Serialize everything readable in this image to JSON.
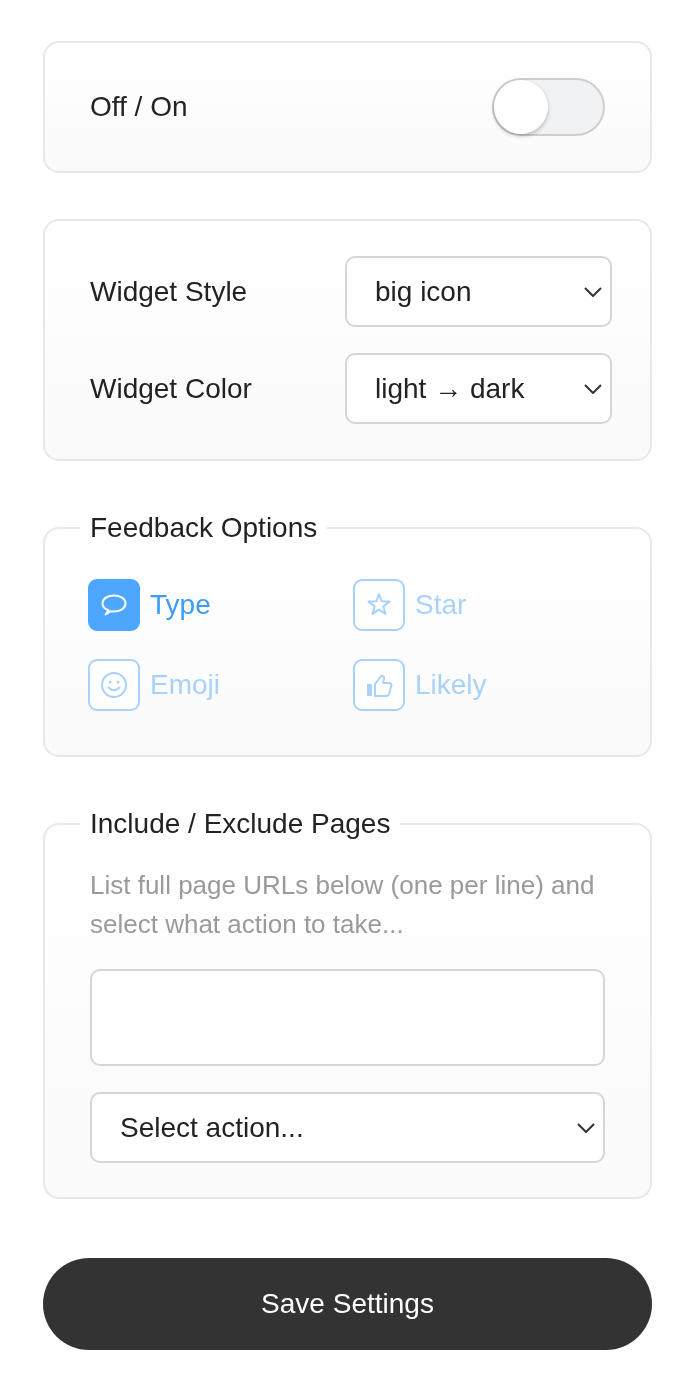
{
  "power": {
    "label": "Off / On",
    "on": false
  },
  "widget_settings": [
    {
      "label": "Widget Style",
      "value": "big icon"
    },
    {
      "label": "Widget Color",
      "value": "light → dark"
    }
  ],
  "feedback_options": {
    "title": "Feedback Options",
    "options": [
      {
        "kind": "speech",
        "label": "Type",
        "selected": true
      },
      {
        "kind": "star",
        "label": "Star",
        "selected": false
      },
      {
        "kind": "emoji",
        "label": "Emoji",
        "selected": false
      },
      {
        "kind": "thumb",
        "label": "Likely",
        "selected": false
      }
    ]
  },
  "pages": {
    "title": "Include / Exclude Pages",
    "help": "List full page URLs below (one per line) and select what action to take...",
    "action_select": {
      "value": "Select action..."
    }
  },
  "save_button": "Save Settings"
}
